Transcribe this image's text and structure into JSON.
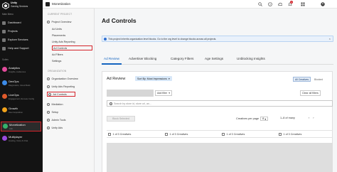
{
  "sidebar": {
    "brand_line1": "Unity",
    "brand_line2": "Gaming Services",
    "org_label": "Main Menu",
    "items": [
      {
        "label": "Dashboard",
        "icon": "dashboard-icon"
      },
      {
        "label": "Projects",
        "icon": "projects-icon"
      },
      {
        "label": "Explore Services",
        "icon": "explore-icon"
      },
      {
        "label": "Help and Support",
        "icon": "help-icon"
      }
    ],
    "section_label": "Suites",
    "suites": [
      {
        "title": "Analytics",
        "subtitle": "Insights, Audiences",
        "color": "#e24b9b"
      },
      {
        "title": "DevOps",
        "subtitle": "Diagnostics, Cloud Build",
        "color": "#3d8be8"
      },
      {
        "title": "LiveOps",
        "subtitle": "Engagement, Remote Config",
        "color": "#e05a2b"
      },
      {
        "title": "Growth",
        "subtitle": "User Acquisition",
        "color": "#f2a31b"
      },
      {
        "title": "Monetization",
        "subtitle": "Ads",
        "color": "#34b36b",
        "active": true
      },
      {
        "title": "Multiplayer",
        "subtitle": "Hosting, Voice & Chat",
        "color": "#9a4be0"
      }
    ]
  },
  "subnav": {
    "title": "Monetization",
    "section1": "CURRENT PROJECT",
    "items1": [
      {
        "label": "Project Overview",
        "sub": false
      },
      {
        "label": "Ad Units",
        "sub": true
      },
      {
        "label": "Placements",
        "sub": true
      },
      {
        "label": "Unity Ads Reporting",
        "sub": true
      },
      {
        "label": "Ad Controls",
        "sub": true,
        "highlight": true
      },
      {
        "label": "Ad Filters",
        "sub": true
      },
      {
        "label": "Settings",
        "sub": true
      }
    ],
    "section2": "ORGANIZATION",
    "items2": [
      {
        "label": "Organization Overview"
      },
      {
        "label": "Unity Ads Reporting"
      },
      {
        "label": "Ad Controls",
        "highlight": true
      },
      {
        "label": "Mediation"
      },
      {
        "label": "Setup"
      },
      {
        "label": "Admin Tools"
      },
      {
        "label": "Unity Ads"
      }
    ]
  },
  "topbar": {
    "icons": [
      "search-icon",
      "help-icon",
      "cloud-icon",
      "notifications-icon",
      "grid-icon",
      "user-icon"
    ],
    "notification_count": "1"
  },
  "main": {
    "title": "Ad Controls",
    "banner_text": "This project inherits organization level blocks. Go to the org level to change blocks across all projects.",
    "tabs": [
      "Ad Review",
      "Advertiser Blocking",
      "Category Filters",
      "Age Settings",
      "Unblocking Insights"
    ],
    "active_tab": "Ad Review"
  },
  "card": {
    "title": "Ad Review",
    "sort_chip": "Sort By: Most Impressions",
    "toggle_all": "All Creatives",
    "toggle_blocked": "Blocked",
    "add_filter": "Add filter",
    "clear_filters": "Clear all filters",
    "search_placeholder": "Search by store id, store url, an...",
    "block_button": "Block Selected",
    "creatives_per_page_label": "Creatives per page",
    "per_page_value": "8",
    "range_label": "1–8 of many",
    "columns": [
      "1 of 3 Creatives",
      "1 of 3 Creatives",
      "1 of 3 Creatives",
      "1 of 3 Creatives"
    ]
  }
}
